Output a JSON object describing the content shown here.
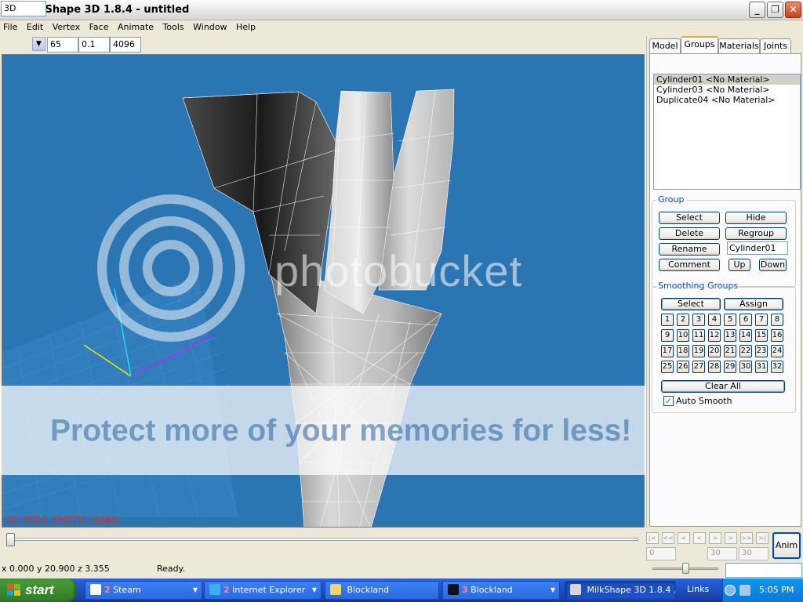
{
  "window": {
    "title": "MilkShape 3D 1.8.4 - untitled",
    "controls": [
      "_",
      "❐",
      "✕"
    ]
  },
  "menu": [
    "File",
    "Edit",
    "Vertex",
    "Face",
    "Animate",
    "Tools",
    "Window",
    "Help"
  ],
  "toolbar": {
    "view_mode": "3D",
    "field1": "65",
    "field2": "0.1",
    "field3": "4096"
  },
  "viewport": {
    "credit": "BY WILL SMITH (9444)",
    "colors": {
      "background": "#2b75b3",
      "grid": "#4c8fc8"
    }
  },
  "watermark": {
    "logo_text": "photobucket",
    "band_text": "Protect more of your memories for less!"
  },
  "panel": {
    "tabs": [
      "Model",
      "Groups",
      "Materials",
      "Joints"
    ],
    "active_tab": "Groups",
    "groups": [
      "Cylinder01 <No Material>",
      "Cylinder03 <No Material>",
      "Duplicate04 <No Material>"
    ],
    "group_box": {
      "title": "Group",
      "select": "Select",
      "hide": "Hide",
      "delete": "Delete",
      "regroup": "Regroup",
      "rename": "Rename",
      "rename_value": "Cylinder01",
      "comment": "Comment",
      "up": "Up",
      "down": "Down"
    },
    "smoothing": {
      "title": "Smoothing Groups",
      "select": "Select",
      "assign": "Assign",
      "numbers": [
        "1",
        "2",
        "3",
        "4",
        "5",
        "6",
        "7",
        "8",
        "9",
        "10",
        "11",
        "12",
        "13",
        "14",
        "15",
        "16",
        "17",
        "18",
        "19",
        "20",
        "21",
        "22",
        "23",
        "24",
        "25",
        "26",
        "27",
        "28",
        "29",
        "30",
        "31",
        "32"
      ],
      "clear_all": "Clear All",
      "auto_smooth": "Auto Smooth",
      "auto_smooth_checked": "✓"
    }
  },
  "animation": {
    "nav": [
      "|<",
      "<<",
      "<",
      "<",
      ">",
      ">",
      ">>",
      ">|"
    ],
    "frame_current": "0",
    "frame_end": "30",
    "frame_total": "30",
    "anim_button": "Anim"
  },
  "status": {
    "coords": "x 0.000 y 20.900 z 3.355",
    "text": "Ready."
  },
  "taskbar": {
    "start": "start",
    "tasks": [
      {
        "num": "2",
        "label": "Steam"
      },
      {
        "num": "2",
        "label": "Internet Explorer"
      },
      {
        "num": "",
        "label": "Blockland"
      },
      {
        "num": "3",
        "label": "Blockland"
      },
      {
        "num": "",
        "label": "MilkShape 3D 1.8.4 ..."
      }
    ],
    "links": "Links",
    "clock": "5:05 PM"
  }
}
